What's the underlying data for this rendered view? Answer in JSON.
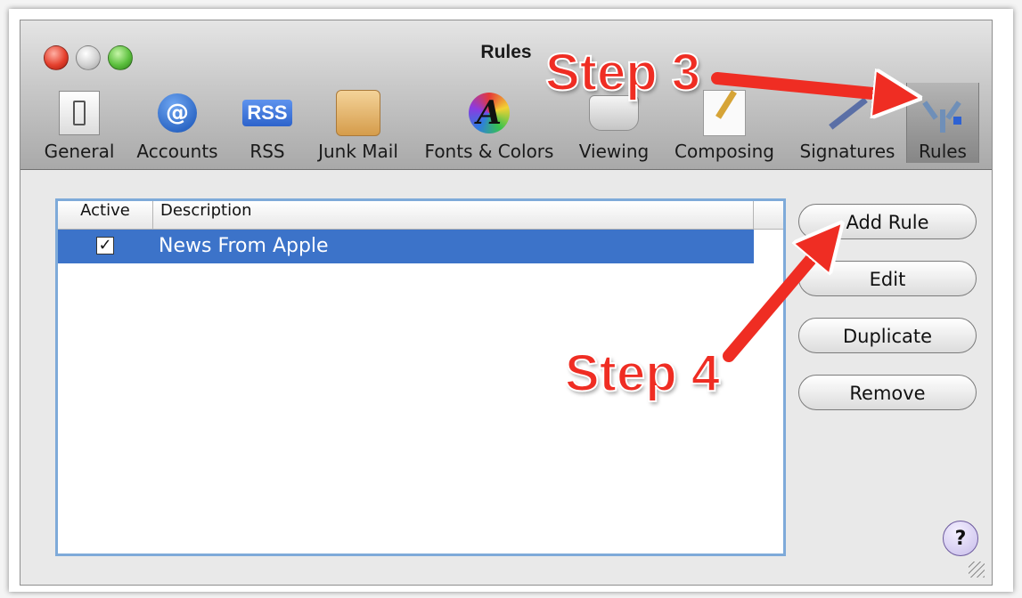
{
  "window": {
    "title": "Rules"
  },
  "toolbar": {
    "items": [
      {
        "label": "General",
        "icon": "general-switch-icon"
      },
      {
        "label": "Accounts",
        "icon": "at-sign-icon"
      },
      {
        "label": "RSS",
        "icon": "rss-icon",
        "icon_text": "RSS"
      },
      {
        "label": "Junk Mail",
        "icon": "junk-mail-bag-icon"
      },
      {
        "label": "Fonts & Colors",
        "icon": "fonts-colors-icon",
        "icon_text": "A"
      },
      {
        "label": "Viewing",
        "icon": "glasses-icon"
      },
      {
        "label": "Composing",
        "icon": "pencil-paper-icon"
      },
      {
        "label": "Signatures",
        "icon": "signature-pen-icon"
      },
      {
        "label": "Rules",
        "icon": "rules-arrows-icon",
        "selected": true
      }
    ]
  },
  "rules_table": {
    "columns": [
      "Active",
      "Description"
    ],
    "rows": [
      {
        "active": true,
        "check_glyph": "✓",
        "description": "News From Apple",
        "selected": true
      }
    ]
  },
  "buttons": {
    "add_rule": "Add Rule",
    "edit": "Edit",
    "duplicate": "Duplicate",
    "remove": "Remove",
    "help": "?"
  },
  "annotations": {
    "step3": "Step 3",
    "step4": "Step 4",
    "color": "#ef2d23"
  },
  "colors": {
    "selection": "#3c73c9",
    "list_focus_ring": "#7eaad9"
  }
}
